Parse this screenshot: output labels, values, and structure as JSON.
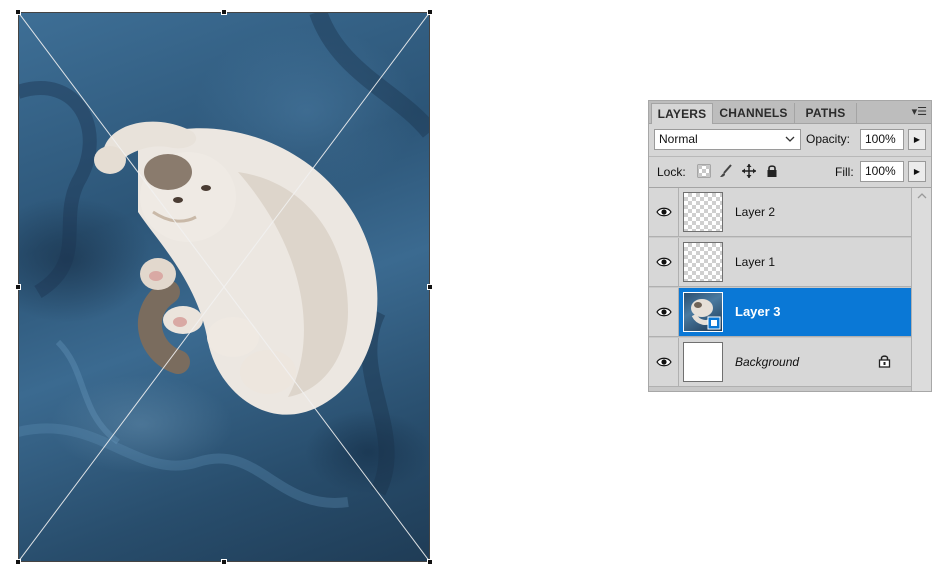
{
  "layers_panel": {
    "tabs": [
      {
        "label": "LAYERS",
        "active": true
      },
      {
        "label": "CHANNELS",
        "active": false
      },
      {
        "label": "PATHS",
        "active": false
      }
    ],
    "menu_icon": "▾☰",
    "blend_mode": "Normal",
    "opacity_label": "Opacity:",
    "opacity_value": "100%",
    "lock_label": "Lock:",
    "fill_label": "Fill:",
    "fill_value": "100%",
    "layers": [
      {
        "name": "Layer 2",
        "thumb": "checker",
        "selected": false,
        "visible": true
      },
      {
        "name": "Layer 1",
        "thumb": "checker",
        "selected": false,
        "visible": true
      },
      {
        "name": "Layer 3",
        "thumb": "photo",
        "selected": true,
        "visible": true
      },
      {
        "name": "Background",
        "thumb": "white",
        "selected": false,
        "visible": true,
        "locked": true
      }
    ],
    "colors": {
      "selected_row": "#0a78d6",
      "panel_bg": "#d6d6d6",
      "tab_bar": "#bdbdbd"
    }
  },
  "canvas": {
    "image_subject": "cat",
    "transform_mode": "free-transform-box"
  }
}
